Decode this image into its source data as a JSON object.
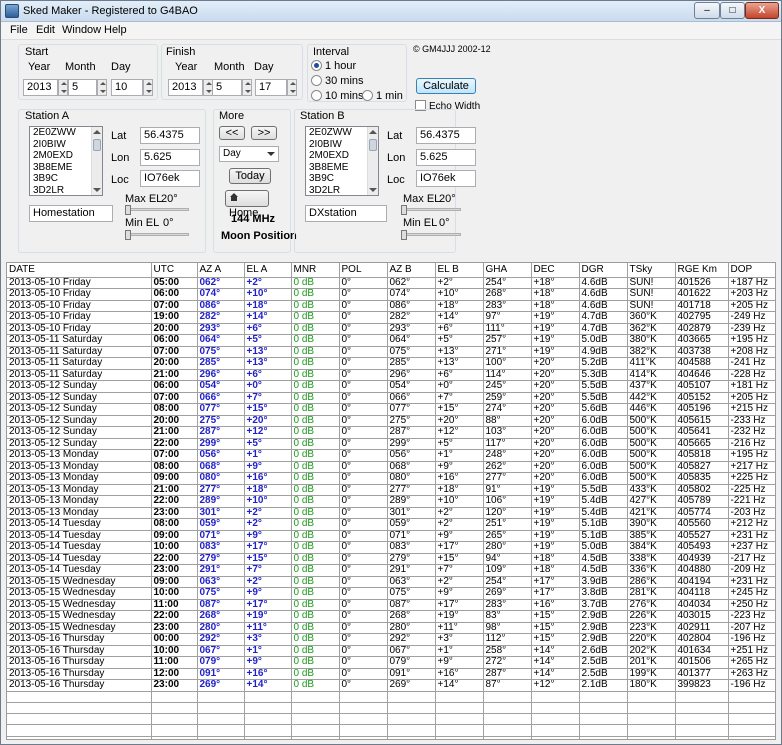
{
  "window": {
    "title": "Sked Maker - Registered to G4BAO",
    "min_symbol": "–",
    "max_symbol": "□",
    "close_symbol": "X"
  },
  "menu": {
    "items": [
      "File",
      "Edit",
      "Window",
      "Help"
    ]
  },
  "copyright": "© GM4JJJ 2002-12",
  "start": {
    "label": "Start",
    "year_label": "Year",
    "month_label": "Month",
    "day_label": "Day",
    "year": "2013",
    "month": "5",
    "day": "10"
  },
  "finish": {
    "label": "Finish",
    "year_label": "Year",
    "month_label": "Month",
    "day_label": "Day",
    "year": "2013",
    "month": "5",
    "day": "17"
  },
  "interval": {
    "label": "Interval",
    "options": [
      "1 hour",
      "30 mins",
      "10 mins",
      "1 min"
    ],
    "selected": "1 hour"
  },
  "calculate_label": "Calculate",
  "echo_width_label": "Echo Width",
  "station_a": {
    "label": "Station A",
    "list": [
      "2E0ZWW",
      "2I0BIW",
      "2M0EXD",
      "3B8EME",
      "3B9C",
      "3D2LR"
    ],
    "lat_label": "Lat",
    "lat": "56.4375",
    "lon_label": "Lon",
    "lon": "5.625",
    "loc_label": "Loc",
    "loc": "IO76ek",
    "maxel_label": "Max EL",
    "maxel": "20°",
    "minel_label": "Min EL",
    "minel": "0°",
    "name": "Homestation"
  },
  "more": {
    "label": "More",
    "prev": "<<",
    "next": ">>",
    "unit": "Day",
    "today": "Today",
    "home": "Home",
    "freq": "144 MHz",
    "mode": "Moon Position"
  },
  "station_b": {
    "label": "Station B",
    "list": [
      "2E0ZWW",
      "2I0BIW",
      "2M0EXD",
      "3B8EME",
      "3B9C",
      "3D2LR"
    ],
    "lat_label": "Lat",
    "lat": "56.4375",
    "lon_label": "Lon",
    "lon": "5.625",
    "loc_label": "Loc",
    "loc": "IO76ek",
    "maxel_label": "Max EL",
    "maxel": "20°",
    "minel_label": "Min EL",
    "minel": "0°",
    "name": "DXstation"
  },
  "table": {
    "columns": [
      "DATE",
      "UTC",
      "AZ A",
      "EL A",
      "MNR",
      "POL",
      "AZ B",
      "EL B",
      "GHA",
      "DEC",
      "DGR",
      "TSky",
      "RGE Km",
      "DOP"
    ],
    "rows": [
      [
        "2013-05-10 Friday",
        "05:00",
        "062°",
        "+2°",
        "0 dB",
        "0°",
        "062°",
        "+2°",
        "254°",
        "+18°",
        "4.6dB",
        "SUN!",
        "401526",
        "+187 Hz"
      ],
      [
        "2013-05-10 Friday",
        "06:00",
        "074°",
        "+10°",
        "0 dB",
        "0°",
        "074°",
        "+10°",
        "268°",
        "+18°",
        "4.6dB",
        "SUN!",
        "401622",
        "+203 Hz"
      ],
      [
        "2013-05-10 Friday",
        "07:00",
        "086°",
        "+18°",
        "0 dB",
        "0°",
        "086°",
        "+18°",
        "283°",
        "+18°",
        "4.6dB",
        "SUN!",
        "401718",
        "+205 Hz"
      ],
      [
        "2013-05-10 Friday",
        "19:00",
        "282°",
        "+14°",
        "0 dB",
        "0°",
        "282°",
        "+14°",
        "97°",
        "+19°",
        "4.7dB",
        "360°K",
        "402795",
        "-249 Hz"
      ],
      [
        "2013-05-10 Friday",
        "20:00",
        "293°",
        "+6°",
        "0 dB",
        "0°",
        "293°",
        "+6°",
        "111°",
        "+19°",
        "4.7dB",
        "362°K",
        "402879",
        "-239 Hz"
      ],
      [
        "2013-05-11 Saturday",
        "06:00",
        "064°",
        "+5°",
        "0 dB",
        "0°",
        "064°",
        "+5°",
        "257°",
        "+19°",
        "5.0dB",
        "380°K",
        "403665",
        "+195 Hz"
      ],
      [
        "2013-05-11 Saturday",
        "07:00",
        "075°",
        "+13°",
        "0 dB",
        "0°",
        "075°",
        "+13°",
        "271°",
        "+19°",
        "4.9dB",
        "382°K",
        "403738",
        "+208 Hz"
      ],
      [
        "2013-05-11 Saturday",
        "20:00",
        "285°",
        "+13°",
        "0 dB",
        "0°",
        "285°",
        "+13°",
        "100°",
        "+20°",
        "5.2dB",
        "411°K",
        "404588",
        "-241 Hz"
      ],
      [
        "2013-05-11 Saturday",
        "21:00",
        "296°",
        "+6°",
        "0 dB",
        "0°",
        "296°",
        "+6°",
        "114°",
        "+20°",
        "5.3dB",
        "414°K",
        "404646",
        "-228 Hz"
      ],
      [
        "2013-05-12 Sunday",
        "06:00",
        "054°",
        "+0°",
        "0 dB",
        "0°",
        "054°",
        "+0°",
        "245°",
        "+20°",
        "5.5dB",
        "437°K",
        "405107",
        "+181 Hz"
      ],
      [
        "2013-05-12 Sunday",
        "07:00",
        "066°",
        "+7°",
        "0 dB",
        "0°",
        "066°",
        "+7°",
        "259°",
        "+20°",
        "5.5dB",
        "442°K",
        "405152",
        "+205 Hz"
      ],
      [
        "2013-05-12 Sunday",
        "08:00",
        "077°",
        "+15°",
        "0 dB",
        "0°",
        "077°",
        "+15°",
        "274°",
        "+20°",
        "5.6dB",
        "446°K",
        "405196",
        "+215 Hz"
      ],
      [
        "2013-05-12 Sunday",
        "20:00",
        "275°",
        "+20°",
        "0 dB",
        "0°",
        "275°",
        "+20°",
        "88°",
        "+20°",
        "6.0dB",
        "500°K",
        "405615",
        "-233 Hz"
      ],
      [
        "2013-05-12 Sunday",
        "21:00",
        "287°",
        "+12°",
        "0 dB",
        "0°",
        "287°",
        "+12°",
        "103°",
        "+20°",
        "6.0dB",
        "500°K",
        "405641",
        "-232 Hz"
      ],
      [
        "2013-05-12 Sunday",
        "22:00",
        "299°",
        "+5°",
        "0 dB",
        "0°",
        "299°",
        "+5°",
        "117°",
        "+20°",
        "6.0dB",
        "500°K",
        "405665",
        "-216 Hz"
      ],
      [
        "2013-05-13 Monday",
        "07:00",
        "056°",
        "+1°",
        "0 dB",
        "0°",
        "056°",
        "+1°",
        "248°",
        "+20°",
        "6.0dB",
        "500°K",
        "405818",
        "+195 Hz"
      ],
      [
        "2013-05-13 Monday",
        "08:00",
        "068°",
        "+9°",
        "0 dB",
        "0°",
        "068°",
        "+9°",
        "262°",
        "+20°",
        "6.0dB",
        "500°K",
        "405827",
        "+217 Hz"
      ],
      [
        "2013-05-13 Monday",
        "09:00",
        "080°",
        "+16°",
        "0 dB",
        "0°",
        "080°",
        "+16°",
        "277°",
        "+20°",
        "6.0dB",
        "500°K",
        "405835",
        "+225 Hz"
      ],
      [
        "2013-05-13 Monday",
        "21:00",
        "277°",
        "+18°",
        "0 dB",
        "0°",
        "277°",
        "+18°",
        "91°",
        "+19°",
        "5.5dB",
        "433°K",
        "405802",
        "-225 Hz"
      ],
      [
        "2013-05-13 Monday",
        "22:00",
        "289°",
        "+10°",
        "0 dB",
        "0°",
        "289°",
        "+10°",
        "106°",
        "+19°",
        "5.4dB",
        "427°K",
        "405789",
        "-221 Hz"
      ],
      [
        "2013-05-13 Monday",
        "23:00",
        "301°",
        "+2°",
        "0 dB",
        "0°",
        "301°",
        "+2°",
        "120°",
        "+19°",
        "5.4dB",
        "421°K",
        "405774",
        "-203 Hz"
      ],
      [
        "2013-05-14 Tuesday",
        "08:00",
        "059°",
        "+2°",
        "0 dB",
        "0°",
        "059°",
        "+2°",
        "251°",
        "+19°",
        "5.1dB",
        "390°K",
        "405560",
        "+212 Hz"
      ],
      [
        "2013-05-14 Tuesday",
        "09:00",
        "071°",
        "+9°",
        "0 dB",
        "0°",
        "071°",
        "+9°",
        "265°",
        "+19°",
        "5.1dB",
        "385°K",
        "405527",
        "+231 Hz"
      ],
      [
        "2013-05-14 Tuesday",
        "10:00",
        "083°",
        "+17°",
        "0 dB",
        "0°",
        "083°",
        "+17°",
        "280°",
        "+19°",
        "5.0dB",
        "384°K",
        "405493",
        "+237 Hz"
      ],
      [
        "2013-05-14 Tuesday",
        "22:00",
        "279°",
        "+15°",
        "0 dB",
        "0°",
        "279°",
        "+15°",
        "94°",
        "+18°",
        "4.5dB",
        "338°K",
        "404939",
        "-217 Hz"
      ],
      [
        "2013-05-14 Tuesday",
        "23:00",
        "291°",
        "+7°",
        "0 dB",
        "0°",
        "291°",
        "+7°",
        "109°",
        "+18°",
        "4.5dB",
        "336°K",
        "404880",
        "-209 Hz"
      ],
      [
        "2013-05-15 Wednesday",
        "09:00",
        "063°",
        "+2°",
        "0 dB",
        "0°",
        "063°",
        "+2°",
        "254°",
        "+17°",
        "3.9dB",
        "286°K",
        "404194",
        "+231 Hz"
      ],
      [
        "2013-05-15 Wednesday",
        "10:00",
        "075°",
        "+9°",
        "0 dB",
        "0°",
        "075°",
        "+9°",
        "269°",
        "+17°",
        "3.8dB",
        "281°K",
        "404118",
        "+245 Hz"
      ],
      [
        "2013-05-15 Wednesday",
        "11:00",
        "087°",
        "+17°",
        "0 dB",
        "0°",
        "087°",
        "+17°",
        "283°",
        "+16°",
        "3.7dB",
        "276°K",
        "404034",
        "+250 Hz"
      ],
      [
        "2013-05-15 Wednesday",
        "22:00",
        "268°",
        "+19°",
        "0 dB",
        "0°",
        "268°",
        "+19°",
        "83°",
        "+15°",
        "2.9dB",
        "226°K",
        "403015",
        "-223 Hz"
      ],
      [
        "2013-05-15 Wednesday",
        "23:00",
        "280°",
        "+11°",
        "0 dB",
        "0°",
        "280°",
        "+11°",
        "98°",
        "+15°",
        "2.9dB",
        "223°K",
        "402911",
        "-207 Hz"
      ],
      [
        "2013-05-16 Thursday",
        "00:00",
        "292°",
        "+3°",
        "0 dB",
        "0°",
        "292°",
        "+3°",
        "112°",
        "+15°",
        "2.9dB",
        "220°K",
        "402804",
        "-196 Hz"
      ],
      [
        "2013-05-16 Thursday",
        "10:00",
        "067°",
        "+1°",
        "0 dB",
        "0°",
        "067°",
        "+1°",
        "258°",
        "+14°",
        "2.6dB",
        "202°K",
        "401634",
        "+251 Hz"
      ],
      [
        "2013-05-16 Thursday",
        "11:00",
        "079°",
        "+9°",
        "0 dB",
        "0°",
        "079°",
        "+9°",
        "272°",
        "+14°",
        "2.5dB",
        "201°K",
        "401506",
        "+265 Hz"
      ],
      [
        "2013-05-16 Thursday",
        "12:00",
        "091°",
        "+16°",
        "0 dB",
        "0°",
        "091°",
        "+16°",
        "287°",
        "+14°",
        "2.5dB",
        "199°K",
        "401377",
        "+263 Hz"
      ],
      [
        "2013-05-16 Thursday",
        "23:00",
        "269°",
        "+14°",
        "0 dB",
        "0°",
        "269°",
        "+14°",
        "87°",
        "+12°",
        "2.1dB",
        "180°K",
        "399823",
        "-196 Hz"
      ]
    ],
    "empty_rows": 5
  }
}
